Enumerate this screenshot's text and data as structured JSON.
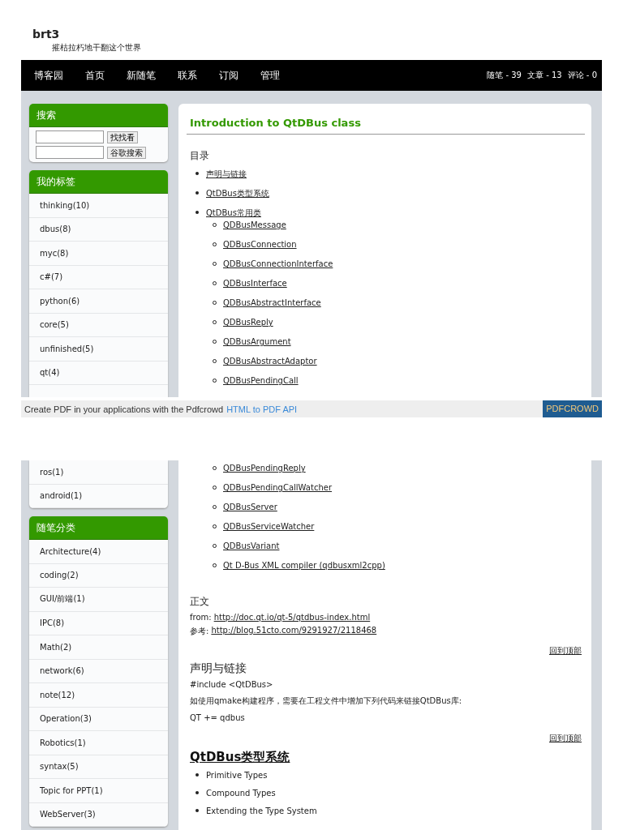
{
  "blog": {
    "title": "brt3",
    "subtitle": "摧枯拉朽地干翻这个世界"
  },
  "nav": {
    "links": [
      "博客园",
      "首页",
      "新随笔",
      "联系",
      "订阅",
      "管理"
    ],
    "stats": [
      "随笔 - 39",
      "文章 - 13",
      "评论 - 0"
    ]
  },
  "page_1": {
    "search": {
      "title": "搜索",
      "buttons": [
        "找找看",
        "谷歌搜索"
      ]
    },
    "tags": {
      "title": "我的标签",
      "items": [
        "thinking(10)",
        "dbus(8)",
        "myc(8)",
        "c#(7)",
        "python(6)",
        "core(5)",
        "unfinished(5)",
        "qt(4)"
      ]
    },
    "post": {
      "title": "Introduction to QtDBus class",
      "toc_heading": "目录",
      "toc": [
        {
          "text": "声明与链接"
        },
        {
          "text": "QtDBus类型系统"
        },
        {
          "text": "QtDBus常用类",
          "children": [
            "QDBusMessage",
            "QDBusConnection",
            "QDBusConnectionInterface",
            "QDBusInterface",
            "QDBusAbstractInterface",
            "QDBusReply",
            "QDBusArgument",
            "QDBusAbstractAdaptor",
            "QDBusPendingCall"
          ]
        }
      ]
    }
  },
  "pdf_footer": {
    "text": "Create PDF in your applications with the Pdfcrowd",
    "link": "HTML to PDF API",
    "badge": "PDFCROWD"
  },
  "page_2": {
    "tags": [
      "ros(1)",
      "android(1)"
    ],
    "categories": {
      "title": "随笔分类",
      "items": [
        "Architecture(4)",
        "coding(2)",
        "GUI/前端(1)",
        "IPC(8)",
        "Math(2)",
        "network(6)",
        "note(12)",
        "Operation(3)",
        "Robotics(1)",
        "syntax(5)",
        "Topic for PPT(1)",
        "WebServer(3)"
      ]
    },
    "toc_children": [
      "QDBusPendingReply",
      "QDBusPendingCallWatcher",
      "QDBusServer",
      "QDBusServiceWatcher",
      "QDBusVariant",
      "Qt D-Bus XML compiler (qdbusxml2cpp)"
    ],
    "blocks": [
      {
        "kind": "heading",
        "text": "正文"
      },
      {
        "kind": "link_line",
        "label": "from:",
        "url": "http://doc.qt.io/qt-5/qtdbus-index.html"
      },
      {
        "kind": "link_line",
        "label": "参考:",
        "url": "http://blog.51cto.com/9291927/2118468"
      },
      {
        "kind": "top_link",
        "text": "回到顶部"
      },
      {
        "kind": "heading",
        "text": "声明与链接"
      },
      {
        "kind": "para",
        "text": "#include <QtDBus>"
      },
      {
        "kind": "para",
        "text": "如使用qmake构建程序，需要在工程文件中增加下列代码来链接QtDBus库:"
      },
      {
        "kind": "para",
        "text": "QT += qdbus"
      },
      {
        "kind": "top_link",
        "text": "回到顶部"
      },
      {
        "kind": "link_heading",
        "text": "QtDBus类型系统"
      },
      {
        "kind": "bullets",
        "items": [
          "Primitive Types",
          "Compound Types",
          "Extending the Type System"
        ]
      }
    ]
  }
}
